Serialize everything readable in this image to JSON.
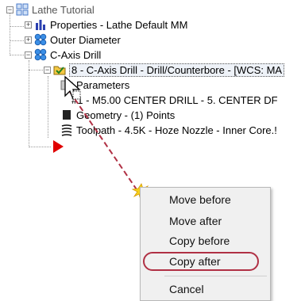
{
  "tree": {
    "root": {
      "label": "Lathe Tutorial",
      "icon": "tree-root-icon"
    },
    "properties": {
      "label": "Properties - Lathe Default MM",
      "expander": "+"
    },
    "outer_diameter": {
      "label": "Outer Diameter",
      "expander": "+"
    },
    "c_axis_drill": {
      "label": "C-Axis Drill",
      "expander": "−"
    },
    "operation": {
      "label": "8 - C-Axis Drill - Drill/Counterbore - [WCS: MA",
      "expander": "−"
    },
    "parameters": {
      "label": "Parameters"
    },
    "tool": {
      "label": "#1 - M5.00 CENTER DRILL -    5. CENTER DF"
    },
    "geometry": {
      "label": "Geometry - (1) Points"
    },
    "toolpath": {
      "label": "Toolpath - 4.5K - Hoze Nozzle - Inner Core.!"
    }
  },
  "context_menu": {
    "items": [
      "Move before",
      "Move after",
      "Copy before",
      "Copy after",
      "Cancel"
    ],
    "highlighted": "Copy after"
  },
  "colors": {
    "insert_arrow": "#e00000",
    "drag_trail": "#b03044",
    "oval": "#b03044",
    "menu_bg": "#f0f0f0"
  }
}
